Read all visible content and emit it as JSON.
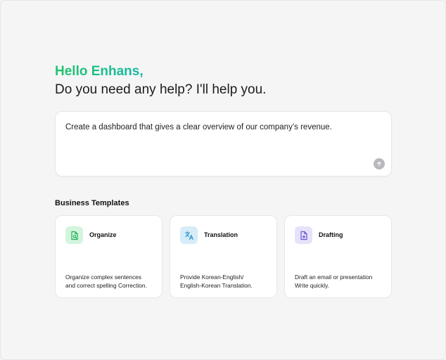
{
  "greeting": "Hello Enhans,",
  "subgreeting": "Do you need any help? I'll help you.",
  "prompt": {
    "text": "Create a dashboard that gives a clear overview of our company’s revenue.",
    "send_icon": "arrow-up-icon"
  },
  "templates": {
    "title": "Business Templates",
    "items": [
      {
        "label": "Organize",
        "icon": "document-search-icon",
        "desc_line1": "Organize complex sentences",
        "desc_line2": "and correct spelling Correction.",
        "icon_bg": "#d3f5dd",
        "icon_color": "#22b15a"
      },
      {
        "label": "Translation",
        "icon": "translate-icon",
        "desc_line1": "Provide Korean-English/",
        "desc_line2": "English-Korean Translation.",
        "icon_bg": "#d6ecf8",
        "icon_color": "#1f8fc8"
      },
      {
        "label": "Drafting",
        "icon": "document-add-icon",
        "desc_line1": "Draft an email or presentation",
        "desc_line2": "Write quickly.",
        "icon_bg": "#e6e2fa",
        "icon_color": "#6b57d6"
      }
    ]
  },
  "colors": {
    "accent_green": "#22c46a",
    "accent_teal": "#14b8a6"
  }
}
